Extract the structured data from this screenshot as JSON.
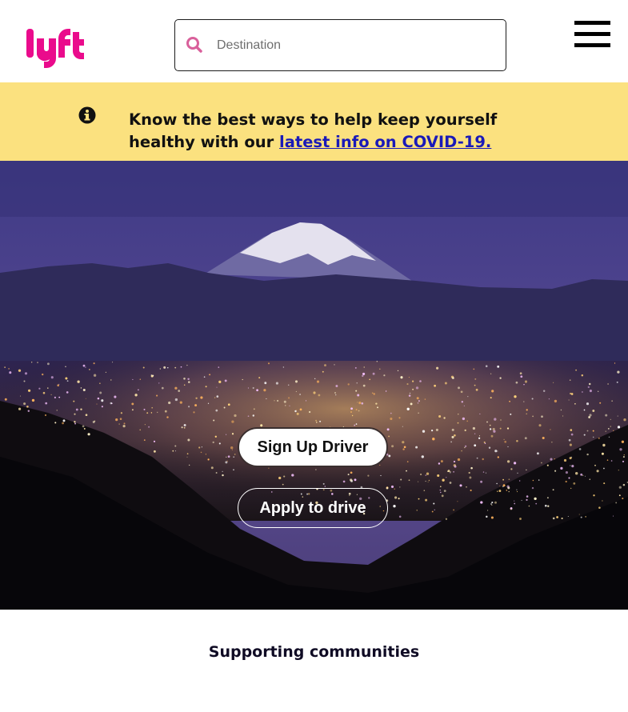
{
  "brand": {
    "logo_text": "lyft",
    "accent": "#ea0b8c"
  },
  "search": {
    "placeholder": "Destination",
    "icon": "search-icon"
  },
  "menu": {
    "icon": "hamburger-menu-icon"
  },
  "banner": {
    "icon": "info-icon",
    "text_before": "Know the best ways to help keep yourself healthy with our ",
    "link_text": "latest info on COVID-19.",
    "background": "#fbe17f"
  },
  "hero": {
    "primary_button": "Sign Up Driver",
    "secondary_button": "Apply to drive"
  },
  "section": {
    "title": "Supporting communities"
  }
}
